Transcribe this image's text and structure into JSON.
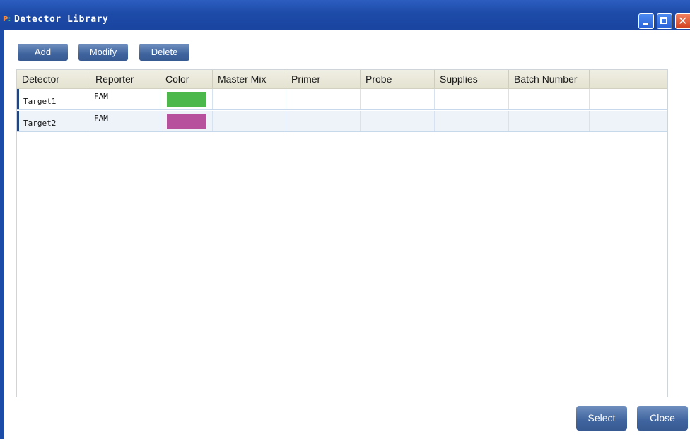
{
  "window": {
    "title": "Detector Library",
    "app_icon": "app-logo-icon",
    "controls": {
      "minimize": "minimize-icon",
      "maximize": "maximize-icon",
      "close": "close-icon"
    }
  },
  "toolbar": {
    "add_label": "Add",
    "modify_label": "Modify",
    "delete_label": "Delete"
  },
  "table": {
    "columns": [
      "Detector",
      "Reporter",
      "Color",
      "Master Mix",
      "Primer",
      "Probe",
      "Supplies",
      "Batch Number"
    ],
    "rows": [
      {
        "detector": "Target1",
        "reporter": "FAM",
        "color": "#4cb84c",
        "master_mix": "",
        "primer": "",
        "probe": "",
        "supplies": "",
        "batch_number": ""
      },
      {
        "detector": "Target2",
        "reporter": "FAM",
        "color": "#b7519e",
        "master_mix": "",
        "primer": "",
        "probe": "",
        "supplies": "",
        "batch_number": ""
      }
    ]
  },
  "footer": {
    "select_label": "Select",
    "close_label": "Close"
  },
  "colors": {
    "titlebar": "#1d4ba8",
    "button": "#3f649e",
    "row_marker": "#23457f"
  }
}
